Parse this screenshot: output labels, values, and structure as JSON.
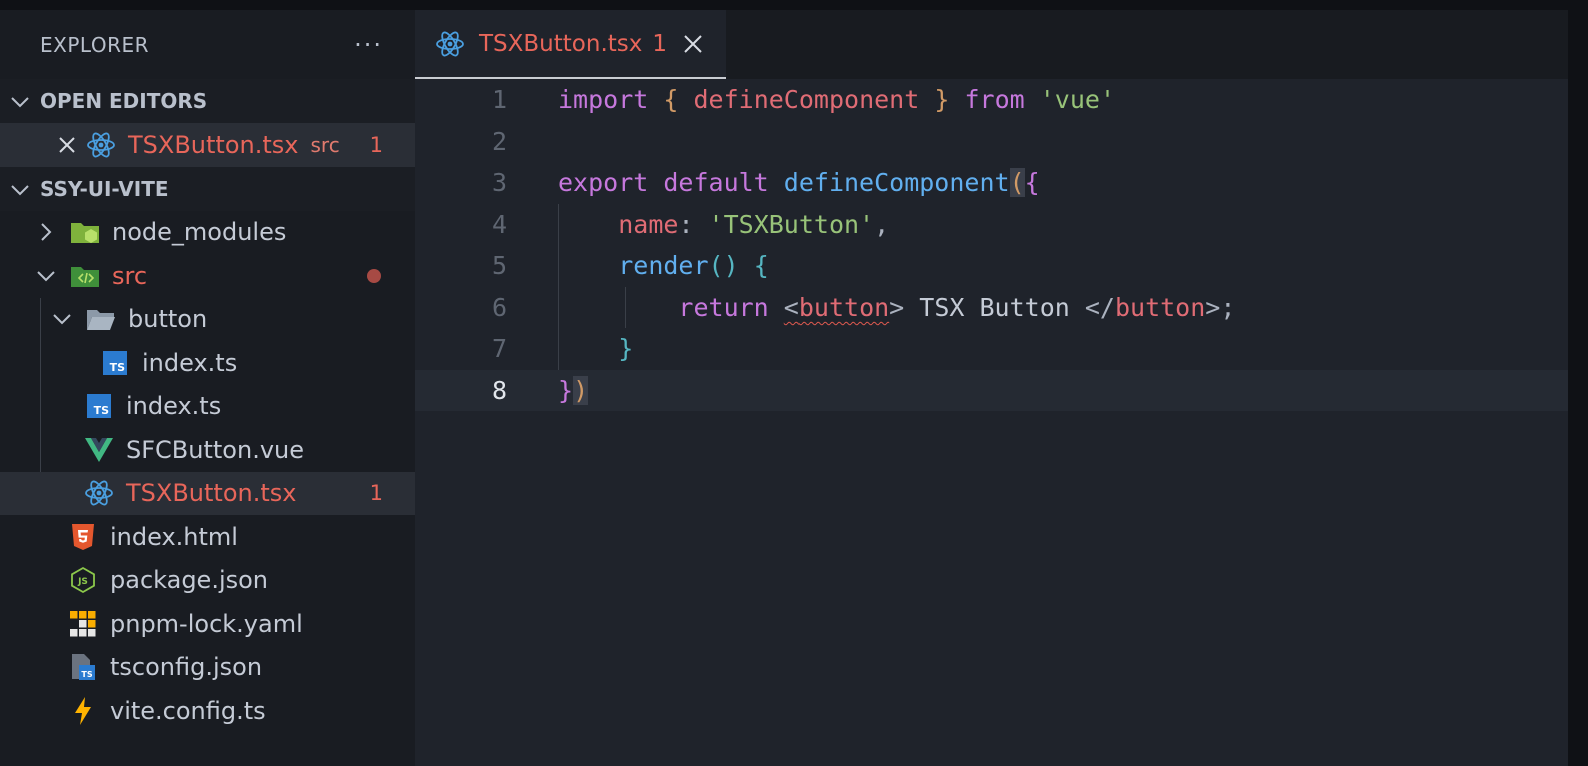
{
  "sidebar": {
    "title": "EXPLORER",
    "more": "···",
    "open_editors": {
      "label": "OPEN EDITORS",
      "item": {
        "name": "TSXButton.tsx",
        "desc": "src",
        "badge": "1"
      }
    },
    "project": {
      "label": "SSY-UI-VITE",
      "items": [
        {
          "name": "node_modules"
        },
        {
          "name": "src"
        },
        {
          "name": "button"
        },
        {
          "name": "index.ts"
        },
        {
          "name": "index.ts"
        },
        {
          "name": "SFCButton.vue"
        },
        {
          "name": "TSXButton.tsx",
          "badge": "1"
        },
        {
          "name": "index.html"
        },
        {
          "name": "package.json"
        },
        {
          "name": "pnpm-lock.yaml"
        },
        {
          "name": "tsconfig.json"
        },
        {
          "name": "vite.config.ts"
        }
      ]
    }
  },
  "editor": {
    "tab": {
      "name": "TSXButton.tsx",
      "badge": "1"
    },
    "line_numbers": [
      "1",
      "2",
      "3",
      "4",
      "5",
      "6",
      "7",
      "8"
    ],
    "code": {
      "l1": {
        "t1": "import",
        "t2": " ",
        "t3": "{",
        "t4": " ",
        "t5": "defineComponent",
        "t6": " ",
        "t7": "}",
        "t8": " ",
        "t9": "from",
        "t10": " ",
        "t11": "'vue'"
      },
      "l3": {
        "t1": "export",
        "t2": " ",
        "t3": "default",
        "t4": " ",
        "t5": "defineComponent",
        "t6": "(",
        "t7": "{"
      },
      "l4": {
        "t1": "    ",
        "t2": "name",
        "t3": ": ",
        "t4": "'TSXButton'",
        "t5": ","
      },
      "l5": {
        "t1": "    ",
        "t2": "render",
        "t3": "()",
        "t4": " ",
        "t5": "{"
      },
      "l6": {
        "t1": "        ",
        "t2": "return",
        "t3": " ",
        "t4": "<",
        "t5": "button",
        "t6": ">",
        "t7": " TSX Button ",
        "t8": "</",
        "t9": "button",
        "t10": ">",
        "t11": ";"
      },
      "l7": {
        "t1": "    ",
        "t2": "}"
      },
      "l8": {
        "t1": "}",
        "t2": ")"
      }
    }
  },
  "colors": {
    "error": "#e8665a",
    "keyword": "#c678dd",
    "function": "#61afef",
    "string": "#98c379",
    "react": "#4a9fe0",
    "vue": "#41b883"
  }
}
